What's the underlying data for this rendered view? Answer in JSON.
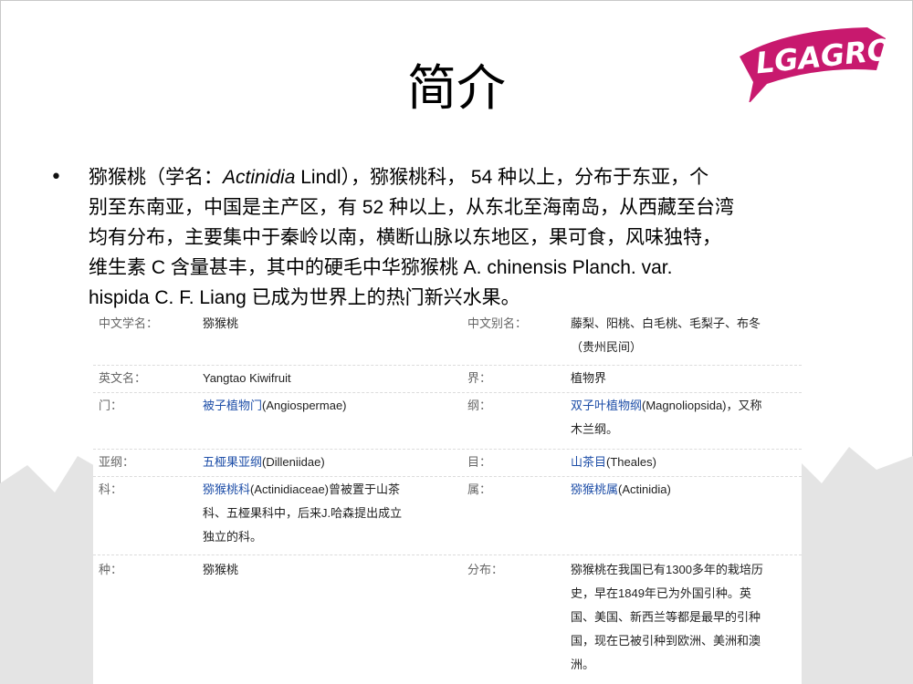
{
  "slide": {
    "title": "简介",
    "logo_text": "LGAGRO",
    "bullet": {
      "name": "猕猴桃（学名：",
      "sci": "Actinidia",
      "rest_line1": " Lindl），猕猴桃科， 54 种以上，分布于东亚，个",
      "lines": [
        "别至东南亚，中国是主产区，有 52 种以上，从东北至海南岛，从西藏至台湾",
        "均有分布，主要集中于秦岭以南，横断山脉以东地区，果可食，风味独特，",
        "维生素 C 含量甚丰，其中的硬毛中华猕猴桃 A. chinensis Planch. var.",
        "hispida C. F. Liang 已成为世界上的热门新兴水果。"
      ]
    }
  },
  "table": {
    "rows": [
      {
        "l1": "中文学名：",
        "v1": "猕猴桃",
        "l2": "中文别名：",
        "v2a": "藤梨、阳桃、白毛桃、毛梨子、布冬",
        "v2b": "（贵州民间）"
      },
      {
        "l1": "英文名：",
        "v1": "Yangtao Kiwifruit",
        "l2": "界：",
        "v2a": "植物界"
      },
      {
        "l1": "门：",
        "v1_link": "被子植物门",
        "v1_rest": "(Angiospermae)",
        "l2": "纲：",
        "v2_link": "双子叶植物纲",
        "v2_rest": "(Magnoliopsida)，又称",
        "v2b": "木兰纲。"
      },
      {
        "l1": "亚纲：",
        "v1_link": "五桠果亚纲",
        "v1_rest": "(Dilleniidae)",
        "l2": "目：",
        "v2_link": "山茶目",
        "v2_rest": "(Theales)"
      },
      {
        "l1": "科：",
        "v1_link": "猕猴桃科",
        "v1_rest": "(Actinidiaceae)曾被置于山茶",
        "v1b": "科、五桠果科中，后来J.哈森提出成立",
        "v1c": "独立的科。",
        "l2": "属：",
        "v2_link": "猕猴桃属",
        "v2_rest": "(Actinidia)"
      },
      {
        "l1": "种：",
        "v1": "猕猴桃",
        "l2": "分布：",
        "v2lines": [
          "猕猴桃在我国已有1300多年的栽培历",
          "史，早在1849年已为外国引种。英",
          "国、美国、新西兰等都是最早的引种",
          "国，现在已被引种到欧洲、美洲和澳",
          "洲。"
        ]
      }
    ]
  }
}
